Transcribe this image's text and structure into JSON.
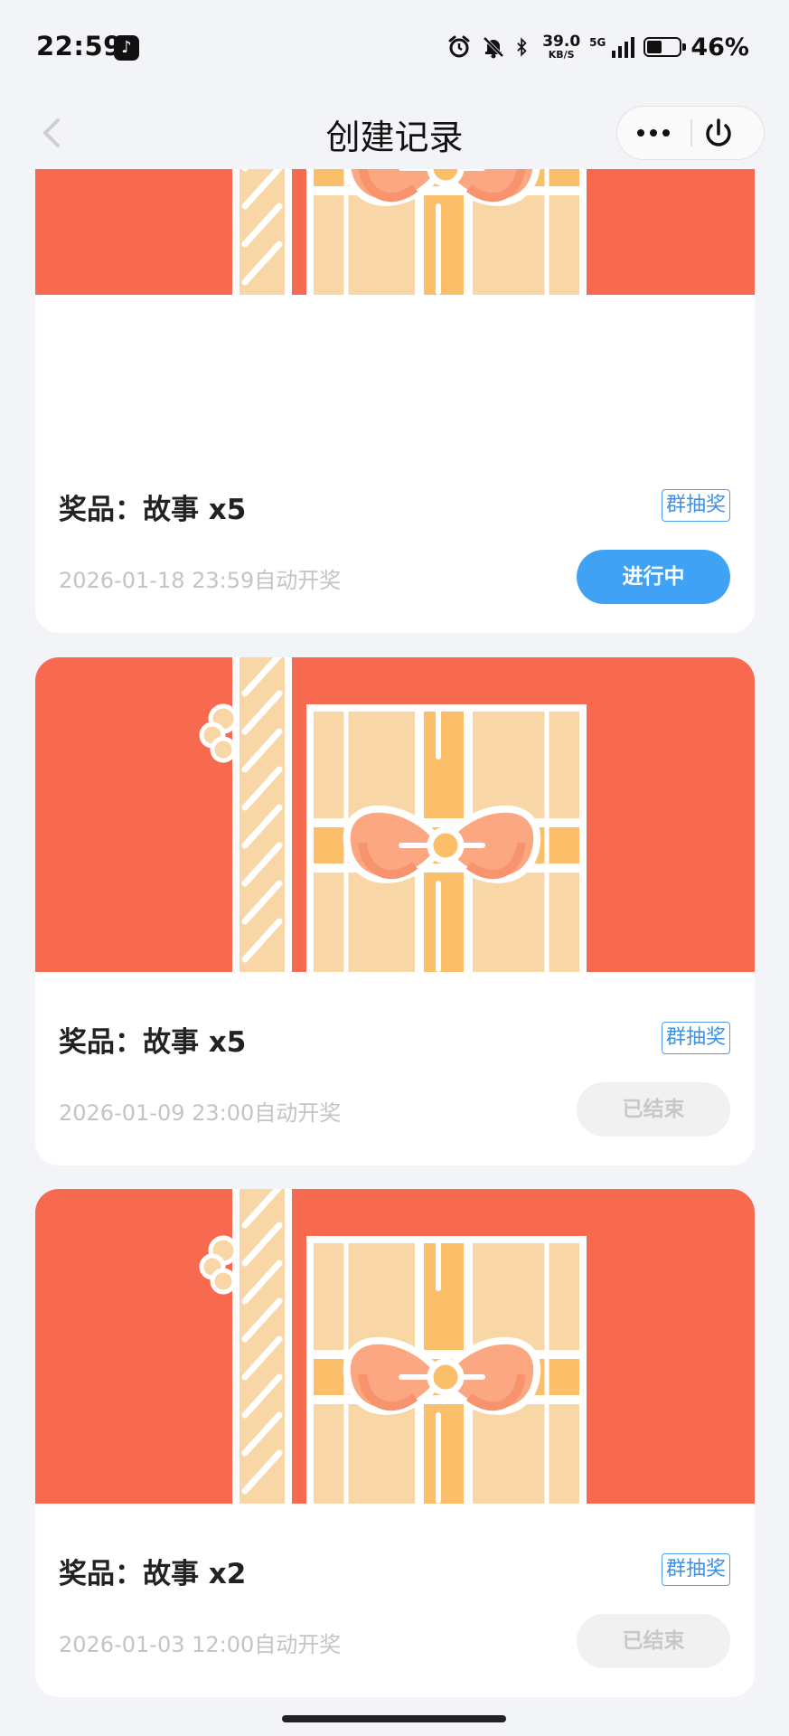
{
  "status_bar": {
    "time": "22:59",
    "net_speed_value": "39.0",
    "net_speed_unit": "KB/S",
    "network": "5G",
    "battery_percent": "46%",
    "battery_level": 0.46
  },
  "nav": {
    "title": "创建记录"
  },
  "colors": {
    "banner_red": "#f76a4f",
    "accent_blue": "#3fa2f4"
  },
  "records": [
    {
      "prize": "奖品：故事 x5",
      "tag": "群抽奖",
      "draw_time": "2026-01-18 23:59自动开奖",
      "status": "进行中",
      "status_type": "active"
    },
    {
      "prize": "奖品：故事 x5",
      "tag": "群抽奖",
      "draw_time": "2026-01-09 23:00自动开奖",
      "status": "已结束",
      "status_type": "ended"
    },
    {
      "prize": "奖品：故事 x2",
      "tag": "群抽奖",
      "draw_time": "2026-01-03 12:00自动开奖",
      "status": "已结束",
      "status_type": "ended"
    }
  ]
}
